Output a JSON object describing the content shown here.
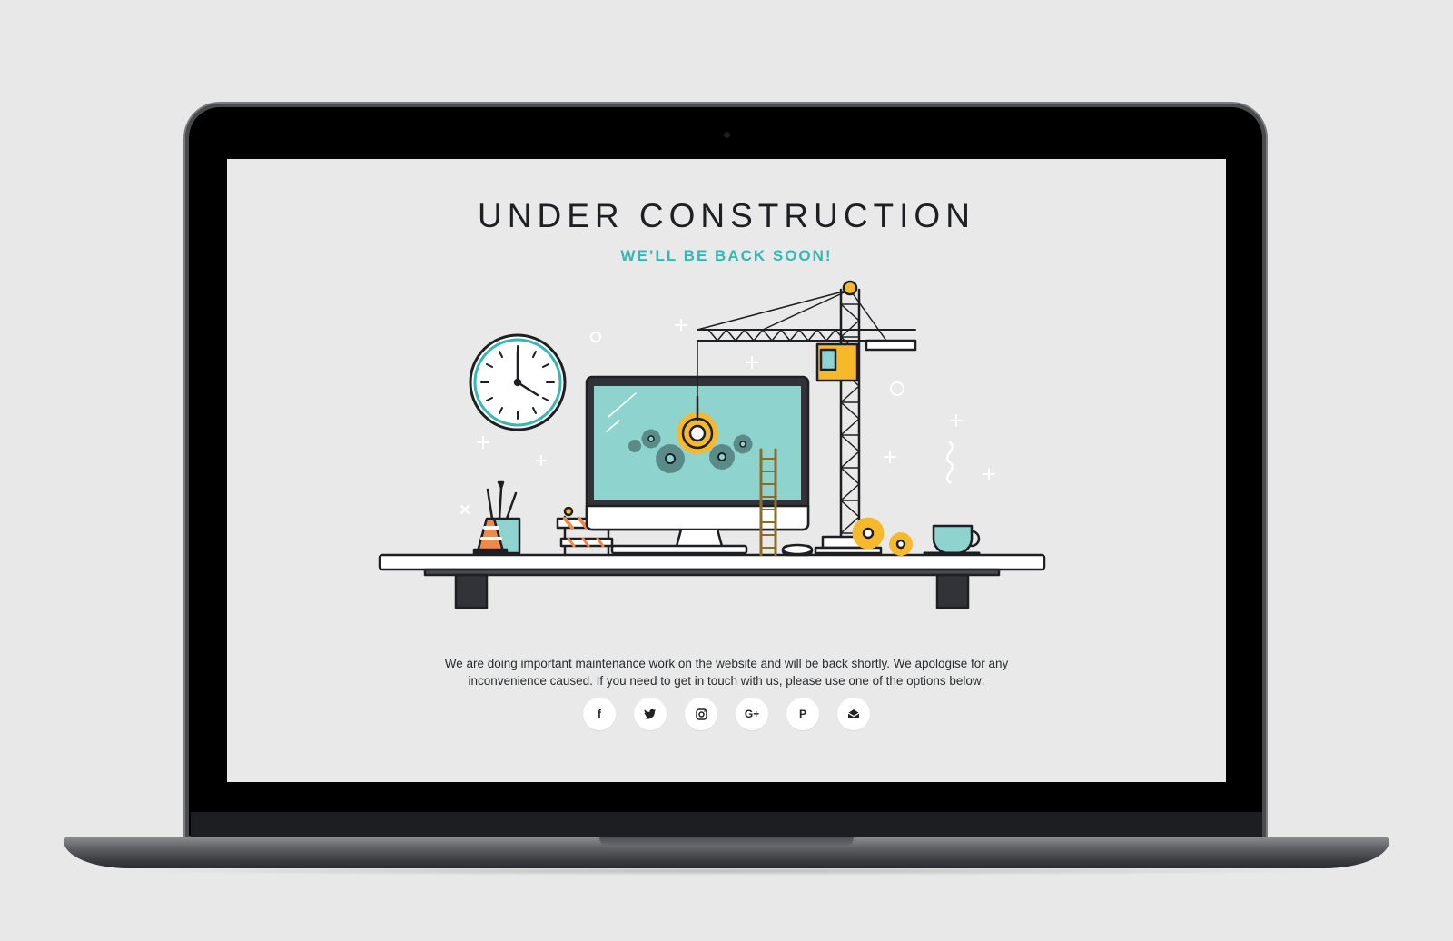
{
  "page": {
    "title": "UNDER CONSTRUCTION",
    "subtitle": "WE’LL BE BACK SOON!",
    "message": "We are doing important maintenance work on the website and will be back shortly. We apologise for any inconvenience caused. If you need to get in touch with us, please use one of the options below:"
  },
  "social": [
    {
      "icon": "facebook-icon",
      "glyph": "f"
    },
    {
      "icon": "twitter-icon",
      "glyph": ""
    },
    {
      "icon": "instagram-icon",
      "glyph": ""
    },
    {
      "icon": "google-plus-icon",
      "glyph": "G+"
    },
    {
      "icon": "pinterest-icon",
      "glyph": "P"
    },
    {
      "icon": "email-icon",
      "glyph": ""
    }
  ],
  "colors": {
    "accent": "#35b7b2",
    "screen_background": "#e8e9e8",
    "monitor_screen": "#8fd3cf",
    "gear_yellow": "#f6b92b",
    "outline": "#1e1f22"
  }
}
